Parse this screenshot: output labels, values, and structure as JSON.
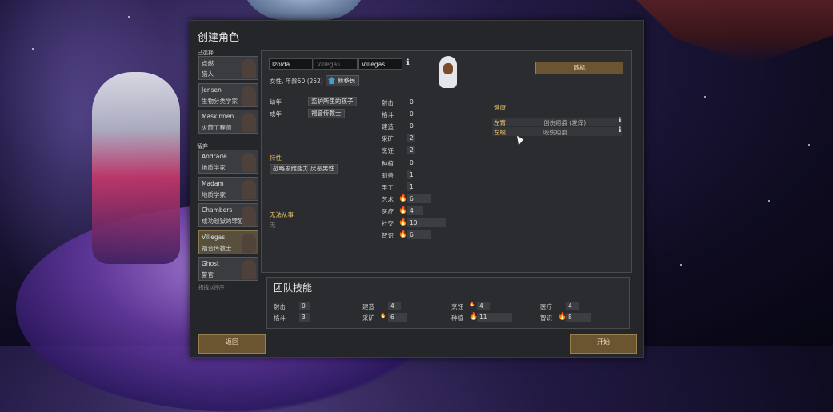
{
  "dialog": {
    "title": "创建角色"
  },
  "sidebar": {
    "chosen_header": "已选择",
    "left_header": "留弃",
    "footer_note": "拖拽以排序",
    "chosen": [
      {
        "name": "点燃",
        "job": "猎人"
      },
      {
        "name": "Jensen",
        "job": "生物分类学家"
      },
      {
        "name": "Maskinnen",
        "job": "火箭工程师"
      }
    ],
    "left": [
      {
        "name": "Andrade",
        "job": "地质学家"
      },
      {
        "name": "Madam",
        "job": "地质学家"
      },
      {
        "name": "Chambers",
        "job": "成功越狱的罪犯"
      },
      {
        "name": "Villegas",
        "job": "福音传教士",
        "selected": true
      },
      {
        "name": "Ghost",
        "job": "警官"
      }
    ]
  },
  "pawn": {
    "first_name": "Izolda",
    "nick_placeholder": "Villegas",
    "last_name": "Villegas",
    "gender_age": "女性, 年龄50 (252)",
    "faction": "新移民",
    "random_label": "随机",
    "backstory": [
      {
        "label": "幼年",
        "value": "监护所里的孩子"
      },
      {
        "label": "成年",
        "value": "福音传教士"
      }
    ],
    "traits_title": "特性",
    "traits": [
      "战略思维能力",
      "厌恶男性"
    ],
    "incapable_title": "无法从事",
    "incapable_value": "无",
    "skills": [
      {
        "label": "射击",
        "value": "0",
        "passion": "",
        "level": 0
      },
      {
        "label": "格斗",
        "value": "0",
        "passion": "",
        "level": 0
      },
      {
        "label": "建造",
        "value": "0",
        "passion": "",
        "level": 0
      },
      {
        "label": "采矿",
        "value": "2",
        "passion": "",
        "level": 2
      },
      {
        "label": "烹饪",
        "value": "2",
        "passion": "",
        "level": 2
      },
      {
        "label": "种植",
        "value": "0",
        "passion": "",
        "level": 0
      },
      {
        "label": "驯兽",
        "value": "1",
        "passion": "",
        "level": 1
      },
      {
        "label": "手工",
        "value": "1",
        "passion": "",
        "level": 1
      },
      {
        "label": "艺术",
        "value": "6",
        "passion": "major",
        "level": 6
      },
      {
        "label": "医疗",
        "value": "4",
        "passion": "major",
        "level": 4
      },
      {
        "label": "社交",
        "value": "10",
        "passion": "major",
        "level": 10
      },
      {
        "label": "智识",
        "value": "6",
        "passion": "major",
        "level": 6
      }
    ],
    "health_title": "健康",
    "health": [
      {
        "part": "左臂",
        "condition": "创伤疤痕 (发痒)"
      },
      {
        "part": "左眼",
        "condition": "咬伤疤痕"
      }
    ]
  },
  "team": {
    "title": "团队技能",
    "skills": [
      {
        "label": "射击",
        "value": "0",
        "passion": "",
        "level": 0
      },
      {
        "label": "格斗",
        "value": "3",
        "passion": "",
        "level": 3
      },
      {
        "label": "建造",
        "value": "4",
        "passion": "",
        "level": 4
      },
      {
        "label": "采矿",
        "value": "6",
        "passion": "minor",
        "level": 6
      },
      {
        "label": "烹饪",
        "value": "4",
        "passion": "minor",
        "level": 4
      },
      {
        "label": "种植",
        "value": "11",
        "passion": "major",
        "level": 11
      },
      {
        "label": "医疗",
        "value": "4",
        "passion": "",
        "level": 4
      },
      {
        "label": "智识",
        "value": "8",
        "passion": "major",
        "level": 8
      }
    ]
  },
  "footer": {
    "back_label": "返回",
    "start_label": "开始"
  },
  "colors": {
    "accent_gold": "#e9c46a",
    "button_brown": "#6b5430",
    "panel": "#2b2c2f",
    "passion": "#e8a030"
  }
}
